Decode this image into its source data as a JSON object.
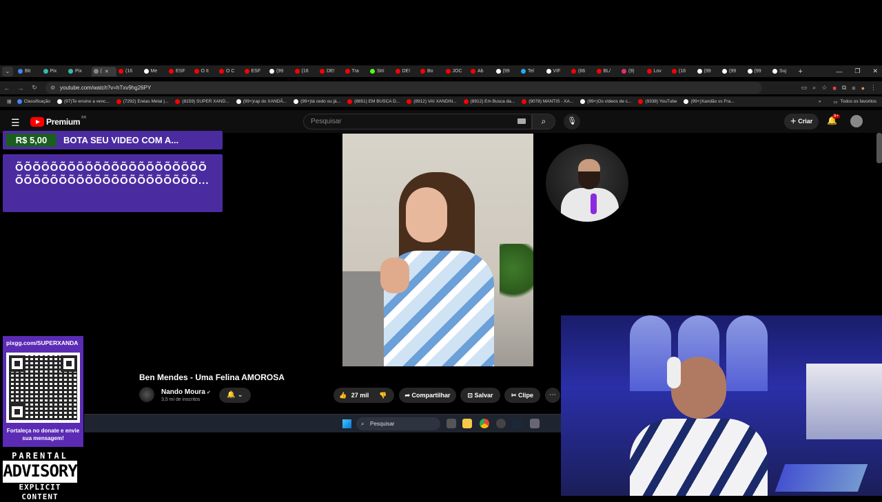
{
  "browser": {
    "tabs": [
      {
        "label": "Bit",
        "color": "#4285f4"
      },
      {
        "label": "Pix",
        "color": "#32bcad"
      },
      {
        "label": "Pix",
        "color": "#32bcad"
      },
      {
        "label": "(",
        "color": "#888888",
        "active": true
      },
      {
        "label": "(16",
        "color": "#ff0000"
      },
      {
        "label": "Me",
        "color": "#ffffff"
      },
      {
        "label": "ESF",
        "color": "#ff0000"
      },
      {
        "label": "O It",
        "color": "#ff0000"
      },
      {
        "label": "O C",
        "color": "#ff0000"
      },
      {
        "label": "ESF",
        "color": "#ff0000"
      },
      {
        "label": "(99",
        "color": "#ffffff"
      },
      {
        "label": "(16",
        "color": "#ff0000"
      },
      {
        "label": "DE!",
        "color": "#ff0000"
      },
      {
        "label": "Tra",
        "color": "#ff0000"
      },
      {
        "label": "Stri",
        "color": "#53fc18"
      },
      {
        "label": "DE!",
        "color": "#ff0000"
      },
      {
        "label": "Bo",
        "color": "#ff0000"
      },
      {
        "label": "JOC",
        "color": "#ff0000"
      },
      {
        "label": "Ab",
        "color": "#ff0000"
      },
      {
        "label": "(99",
        "color": "#ffffff"
      },
      {
        "label": "Tel",
        "color": "#2aabee"
      },
      {
        "label": "VIF",
        "color": "#ffffff"
      },
      {
        "label": "(66",
        "color": "#ff0000"
      },
      {
        "label": "BL/",
        "color": "#ff0000"
      },
      {
        "label": "(9)",
        "color": "#e1306c"
      },
      {
        "label": "Lov",
        "color": "#ff0000"
      },
      {
        "label": "(16",
        "color": "#ff0000"
      },
      {
        "label": "(99",
        "color": "#ffffff"
      },
      {
        "label": "(99",
        "color": "#ffffff"
      },
      {
        "label": "(99",
        "color": "#ffffff"
      },
      {
        "label": "Suj",
        "color": "#ffffff"
      }
    ],
    "url": "youtube.com/watch?v=hTxv9hg26PY",
    "bookmarks": [
      {
        "label": "Classificação",
        "color": "#4285f4"
      },
      {
        "label": "(97)Te ensino a venc...",
        "color": "#ffffff"
      },
      {
        "label": "(7292) Enéas Metal |...",
        "color": "#ff0000"
      },
      {
        "label": "(8159) SUPER XAND...",
        "color": "#ff0000"
      },
      {
        "label": "(99+)rap do XANDÃ...",
        "color": "#ffffff"
      },
      {
        "label": "(99+)tá cedo ou já...",
        "color": "#ffffff"
      },
      {
        "label": "(8851) EM BUSCA D...",
        "color": "#ff0000"
      },
      {
        "label": "(8912) VAI XANDIN...",
        "color": "#ff0000"
      },
      {
        "label": "(8912) Em Busca da...",
        "color": "#ff0000"
      },
      {
        "label": "(9078) MANTIS - XA...",
        "color": "#ff0000"
      },
      {
        "label": "(99+)Os vídeos de c...",
        "color": "#ffffff"
      },
      {
        "label": "(9338) YouTube",
        "color": "#ff0000"
      },
      {
        "label": "(99+)Xandão vs Fra...",
        "color": "#ffffff"
      }
    ],
    "bookmarks_right": "Todos os favoritos"
  },
  "youtube": {
    "logo": "Premium",
    "country": "BR",
    "search_placeholder": "Pesquisar",
    "create_label": "Criar",
    "notif_badge": "9+",
    "video_title": "Ben Mendes - Uma Felina AMOROSA",
    "channel_name": "Nando Moura",
    "subscribers": "3,5 mi de inscritos",
    "likes": "27 mil",
    "share_label": "Compartilhar",
    "save_label": "Salvar",
    "clip_label": "Clipe"
  },
  "donation": {
    "price": "R$ 5,00",
    "title": "BOTA SEU VIDEO COM A...",
    "message": "ÕÕÕÕÕÕÕÕÕÕÕÕÕÕÕÕÕÕÕÕÕÕÕÕÕÕÕÕÕÕÕÕÕÕÕÕÕÕÕÕÕÕÕ..."
  },
  "taskbar": {
    "search_label": "Pesquisar"
  },
  "qr": {
    "url": "pixgg.com/SUPERXANDA",
    "caption": "Fortaleça no donate e envie sua mensagem!"
  },
  "advisory": {
    "top": "PARENTAL",
    "middle": "ADVISORY",
    "bottom": "EXPLICIT CONTENT"
  }
}
